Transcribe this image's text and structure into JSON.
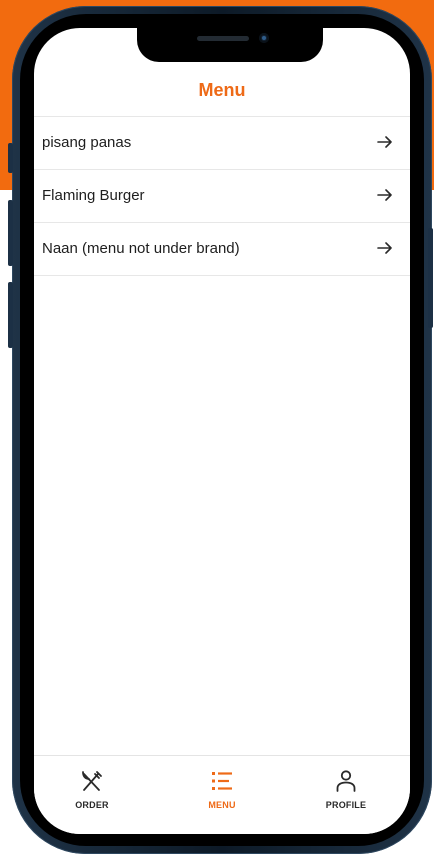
{
  "header": {
    "title": "Menu"
  },
  "menu_items": [
    {
      "label": "pisang panas",
      "icon": "arrow-right-icon"
    },
    {
      "label": "Flaming Burger",
      "icon": "arrow-right-icon"
    },
    {
      "label": "Naan (menu not under brand)",
      "icon": "arrow-right-icon"
    }
  ],
  "tabs": [
    {
      "label": "ORDER",
      "icon": "fork-knife-icon",
      "active": false
    },
    {
      "label": "MENU",
      "icon": "list-icon",
      "active": true
    },
    {
      "label": "PROFILE",
      "icon": "person-icon",
      "active": false
    }
  ],
  "colors": {
    "accent": "#EE6A17",
    "backdrop": "#F26B0F",
    "text": "#1E1E1E",
    "divider": "#E7E7E7"
  }
}
